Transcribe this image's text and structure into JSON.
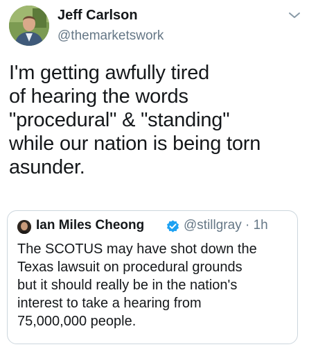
{
  "tweet": {
    "author_name": "Jeff Carlson",
    "author_handle": "@themarketswork",
    "avatar_icon": "profile-photo",
    "more_icon": "chevron-down-icon",
    "text": "I'm getting awfully tired\nof hearing the words\n\"procedural\" & \"standing\"\nwhile our nation is being torn\nasunder."
  },
  "quoted_tweet": {
    "author_name": "Ian Miles Cheong",
    "verified_icon": "verified-badge-icon",
    "handle_and_time": "@stillgray · 1h",
    "text": "The SCOTUS may have shot down the\nTexas lawsuit on procedural grounds\nbut it should really be in the nation's\ninterest to take a hearing from\n75,000,000 people."
  },
  "colors": {
    "text": "#14171a",
    "secondary_text": "#657786",
    "border": "#ccd6dd",
    "verified": "#1da1f2"
  }
}
